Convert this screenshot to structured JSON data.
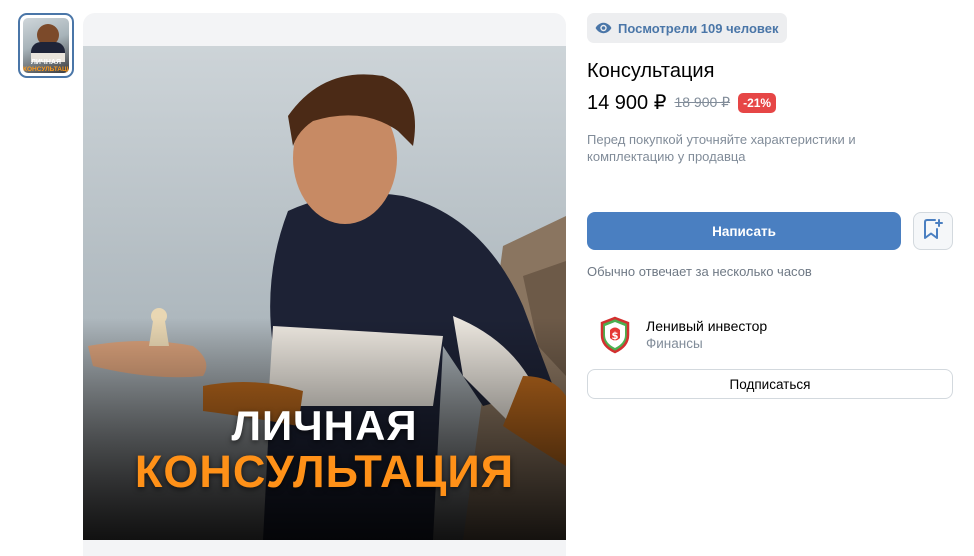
{
  "gallery": {
    "thumbnail_text_line1": "ЛИЧНАЯ",
    "thumbnail_text_line2": "КОНСУЛЬТАЦИЯ",
    "photo_text_line1": "ЛИЧНАЯ",
    "photo_text_line2": "КОНСУЛЬТАЦИЯ"
  },
  "views": {
    "icon": "eye-icon",
    "label": "Посмотрели 109 человек"
  },
  "product": {
    "title": "Консультация",
    "price": "14 900 ₽",
    "old_price": "18 900 ₽",
    "discount": "-21%",
    "note": "Перед покупкой уточняйте характеристики и комплектацию у продавца"
  },
  "actions": {
    "write_label": "Написать",
    "favorite_icon": "bookmark-add-icon",
    "reply_time": "Обычно отвечает за несколько часов"
  },
  "seller": {
    "name": "Ленивый инвестор",
    "category": "Финансы",
    "subscribe_label": "Подписаться"
  },
  "colors": {
    "accent": "#4a7fc1",
    "link": "#4a76a8",
    "discount": "#e64646",
    "orange_text": "#ff9118"
  }
}
